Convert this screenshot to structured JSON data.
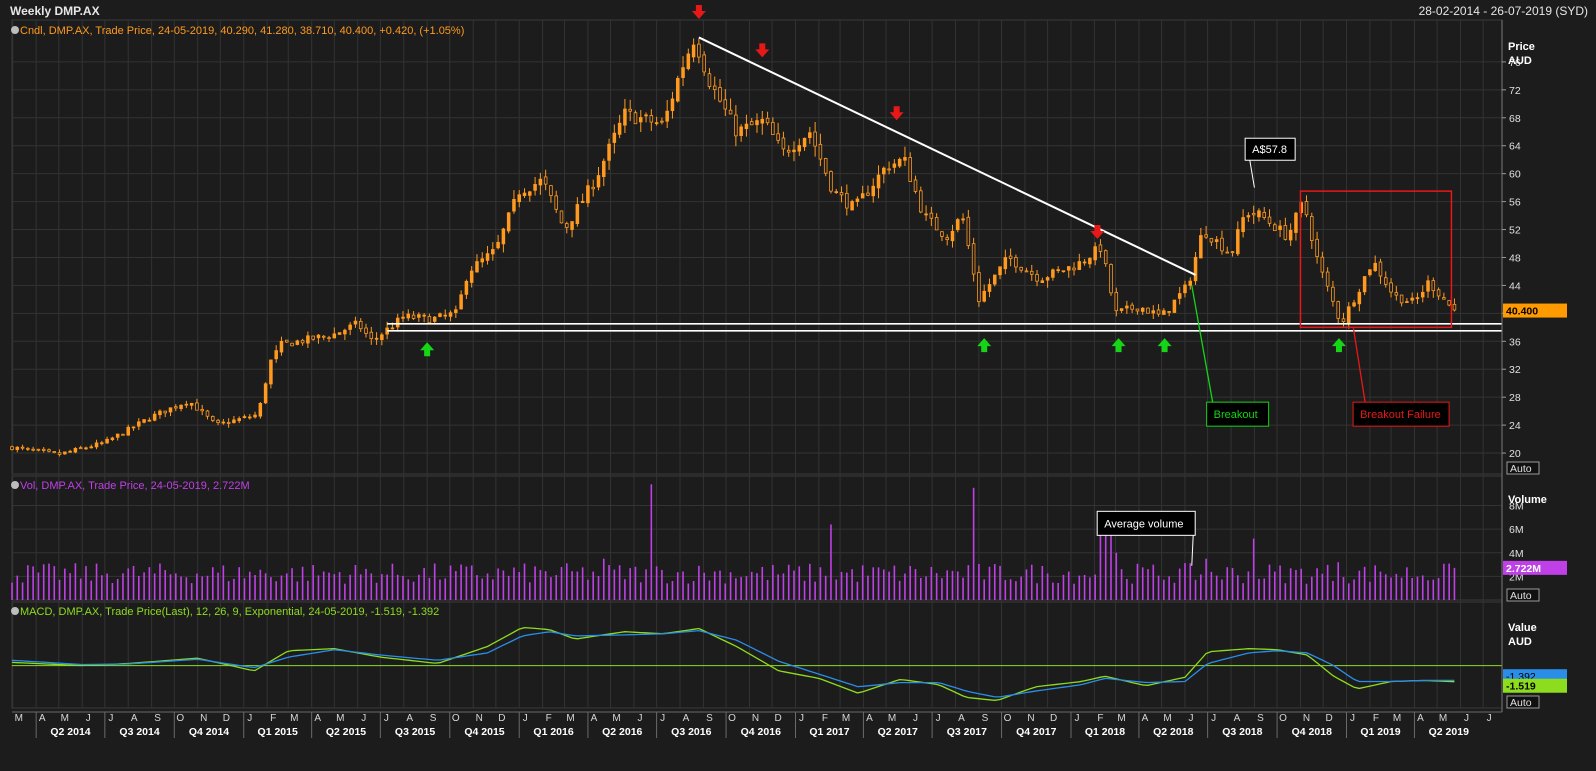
{
  "header": {
    "title": "Weekly DMP.AX",
    "range": "28-02-2014 - 26-07-2019 (SYD)"
  },
  "colors": {
    "candle": "#ff9a1f",
    "volume": "#c040e8",
    "macd": "#8ddc1e",
    "signal": "#2a8de8",
    "background": "#1c1c1c",
    "grid": "#333333",
    "annotation_white": "#ffffff",
    "annotation_green": "#16d416",
    "annotation_red": "#e81818"
  },
  "chart_data": [
    {
      "type": "candlestick",
      "name": "price",
      "legend": "Cndl, DMP.AX, Trade Price, 24-05-2019, 40.290, 41.280, 38.710, 40.400, +0.420, (+1.05%)",
      "ylabel": "Price",
      "yunit": "AUD",
      "ylim": [
        17,
        82
      ],
      "yticks": [
        20,
        24,
        28,
        32,
        36,
        40,
        44,
        48,
        52,
        56,
        60,
        64,
        68,
        72,
        76
      ],
      "last_value_label": "40.400",
      "auto_label": "Auto",
      "close_anchors": [
        [
          "2014-02-28",
          20.8
        ],
        [
          "2014-05-01",
          19.8
        ],
        [
          "2014-07-01",
          21.5
        ],
        [
          "2014-09-01",
          25.2
        ],
        [
          "2014-10-20",
          27.5
        ],
        [
          "2014-11-25",
          24.0
        ],
        [
          "2015-01-20",
          25.5
        ],
        [
          "2015-02-05",
          33.0
        ],
        [
          "2015-02-20",
          35.5
        ],
        [
          "2015-05-01",
          37.0
        ],
        [
          "2015-06-01",
          38.5
        ],
        [
          "2015-06-20",
          36.0
        ],
        [
          "2015-08-01",
          39.5
        ],
        [
          "2015-09-10",
          39.2
        ],
        [
          "2015-10-10",
          40.0
        ],
        [
          "2015-10-25",
          46.0
        ],
        [
          "2015-12-01",
          49.0
        ],
        [
          "2016-01-01",
          57.5
        ],
        [
          "2016-02-01",
          59.0
        ],
        [
          "2016-03-01",
          52.0
        ],
        [
          "2016-04-10",
          59.0
        ],
        [
          "2016-05-20",
          68.5
        ],
        [
          "2016-07-10",
          67.0
        ],
        [
          "2016-08-01",
          74.5
        ],
        [
          "2016-08-20",
          79.5
        ],
        [
          "2016-09-10",
          73.0
        ],
        [
          "2016-10-15",
          66.0
        ],
        [
          "2016-11-20",
          67.5
        ],
        [
          "2016-12-15",
          63.0
        ],
        [
          "2017-01-20",
          66.0
        ],
        [
          "2017-02-20",
          57.5
        ],
        [
          "2017-03-20",
          55.0
        ],
        [
          "2017-05-01",
          61.0
        ],
        [
          "2017-05-25",
          62.0
        ],
        [
          "2017-06-20",
          54.0
        ],
        [
          "2017-07-20",
          51.0
        ],
        [
          "2017-08-10",
          54.0
        ],
        [
          "2017-09-01",
          42.0
        ],
        [
          "2017-10-10",
          48.0
        ],
        [
          "2017-11-20",
          45.0
        ],
        [
          "2018-01-10",
          47.0
        ],
        [
          "2018-02-10",
          49.5
        ],
        [
          "2018-03-01",
          40.0
        ],
        [
          "2018-04-01",
          41.0
        ],
        [
          "2018-05-01",
          39.5
        ],
        [
          "2018-06-05",
          44.0
        ],
        [
          "2018-06-25",
          52.0
        ],
        [
          "2018-08-01",
          48.5
        ],
        [
          "2018-08-20",
          54.5
        ],
        [
          "2018-09-10",
          54.0
        ],
        [
          "2018-10-15",
          51.0
        ],
        [
          "2018-11-05",
          56.0
        ],
        [
          "2018-11-25",
          47.0
        ],
        [
          "2018-12-25",
          38.5
        ],
        [
          "2019-02-05",
          47.5
        ],
        [
          "2019-03-05",
          42.5
        ],
        [
          "2019-04-01",
          41.5
        ],
        [
          "2019-04-20",
          44.5
        ],
        [
          "2019-05-24",
          40.4
        ]
      ],
      "annotations": {
        "resistance_line": {
          "from": [
            "2016-08-26",
            79.5
          ],
          "to": [
            "2018-06-15",
            45.5
          ]
        },
        "support_lines": [
          {
            "from": [
              "2015-07-10",
              38.5
            ],
            "to": [
              "2019-07-26",
              38.5
            ]
          },
          {
            "from": [
              "2015-07-10",
              37.5
            ],
            "to": [
              "2019-07-26",
              37.5
            ]
          }
        ],
        "red_arrows": [
          [
            "2016-08-26",
            83.0
          ],
          [
            "2016-11-18",
            77.5
          ],
          [
            "2017-05-15",
            68.5
          ],
          [
            "2018-02-05",
            51.5
          ]
        ],
        "green_arrows": [
          [
            "2015-09-01",
            35.0
          ],
          [
            "2017-09-08",
            35.6
          ],
          [
            "2018-03-05",
            35.6
          ],
          [
            "2018-05-05",
            35.6
          ],
          [
            "2018-12-22",
            35.6
          ]
        ],
        "price_callout": {
          "text": "A$57.8",
          "at": [
            "2018-09-01",
            58.0
          ],
          "box": [
            "2018-08-25",
            64.5
          ]
        },
        "breakout_label": {
          "text": "Breakout",
          "at": [
            "2018-06-10",
            44.0
          ],
          "box": [
            "2018-07-05",
            27.0
          ]
        },
        "failure_box": {
          "from": [
            "2018-11-01",
            57.5
          ],
          "to": [
            "2019-05-20",
            38.0
          ]
        },
        "failure_label": {
          "text": "Breakout Failure",
          "box": [
            "2019-01-15",
            27.0
          ]
        }
      }
    },
    {
      "type": "bar",
      "name": "volume",
      "legend": "Vol, DMP.AX, Trade Price, 24-05-2019, 2.722M",
      "ylabel": "Volume",
      "yticks": [
        2,
        4,
        6,
        8
      ],
      "ytick_labels": [
        "2M",
        "4M",
        "6M",
        "8M"
      ],
      "ylim": [
        0,
        10.5
      ],
      "last_value_label": "2.722M",
      "auto_label": "Auto",
      "typical_value": 2.5,
      "spikes": [
        [
          "2016-06-24",
          9.8
        ],
        [
          "2016-04-22",
          3.5
        ],
        [
          "2017-02-17",
          6.4
        ],
        [
          "2017-08-25",
          9.5
        ],
        [
          "2018-02-09",
          5.5
        ],
        [
          "2018-02-16",
          5.5
        ],
        [
          "2018-02-23",
          5.5
        ],
        [
          "2018-03-02",
          4.0
        ],
        [
          "2018-06-29",
          3.5
        ],
        [
          "2018-08-31",
          5.2
        ],
        [
          "2018-12-21",
          3.2
        ],
        [
          "2019-02-15",
          2.4
        ],
        [
          "2019-05-24",
          2.72
        ]
      ],
      "annotation": {
        "text": "Average volume",
        "at": [
          "2018-06-10",
          2.9
        ],
        "box": [
          "2018-02-10",
          7.0
        ]
      }
    },
    {
      "type": "line",
      "name": "macd",
      "legend": "MACD, DMP.AX, Trade Price(Last), 12, 26, 9, Exponential, 24-05-2019, -1.519, -1.392",
      "ylabel": "Value",
      "yunit": "AUD",
      "zero_line": 0,
      "ylim": [
        -4,
        6
      ],
      "value_labels": [
        "-1.392",
        "-1.519"
      ],
      "auto_label": "Auto",
      "series": [
        {
          "name": "MACD",
          "color_key": "macd",
          "points": [
            [
              "2014-02-28",
              0.3
            ],
            [
              "2014-06-01",
              0.0
            ],
            [
              "2014-08-01",
              0.2
            ],
            [
              "2014-11-01",
              0.7
            ],
            [
              "2015-01-15",
              -0.5
            ],
            [
              "2015-03-01",
              1.4
            ],
            [
              "2015-05-01",
              1.6
            ],
            [
              "2015-07-01",
              0.8
            ],
            [
              "2015-09-15",
              0.2
            ],
            [
              "2015-11-20",
              1.8
            ],
            [
              "2016-01-05",
              3.6
            ],
            [
              "2016-02-10",
              3.4
            ],
            [
              "2016-03-15",
              2.5
            ],
            [
              "2016-05-20",
              3.2
            ],
            [
              "2016-07-10",
              3.0
            ],
            [
              "2016-08-26",
              3.5
            ],
            [
              "2016-10-15",
              1.8
            ],
            [
              "2016-12-10",
              -0.5
            ],
            [
              "2017-02-01",
              -1.2
            ],
            [
              "2017-03-25",
              -2.6
            ],
            [
              "2017-05-20",
              -1.3
            ],
            [
              "2017-07-10",
              -1.8
            ],
            [
              "2017-08-15",
              -3.0
            ],
            [
              "2017-09-25",
              -3.3
            ],
            [
              "2017-11-15",
              -2.0
            ],
            [
              "2018-01-15",
              -1.5
            ],
            [
              "2018-02-15",
              -1.0
            ],
            [
              "2018-04-10",
              -1.9
            ],
            [
              "2018-06-01",
              -1.1
            ],
            [
              "2018-07-01",
              1.3
            ],
            [
              "2018-08-25",
              1.6
            ],
            [
              "2018-10-01",
              1.5
            ],
            [
              "2018-11-10",
              1.0
            ],
            [
              "2018-12-15",
              -1.0
            ],
            [
              "2019-01-15",
              -2.2
            ],
            [
              "2019-03-01",
              -1.5
            ],
            [
              "2019-04-15",
              -1.4
            ],
            [
              "2019-05-24",
              -1.519
            ]
          ]
        },
        {
          "name": "Signal",
          "color_key": "signal",
          "points": [
            [
              "2014-02-28",
              0.5
            ],
            [
              "2014-06-01",
              0.1
            ],
            [
              "2014-08-01",
              0.15
            ],
            [
              "2014-11-01",
              0.6
            ],
            [
              "2015-01-15",
              -0.2
            ],
            [
              "2015-03-01",
              0.8
            ],
            [
              "2015-05-01",
              1.5
            ],
            [
              "2015-07-01",
              1.0
            ],
            [
              "2015-09-15",
              0.5
            ],
            [
              "2015-11-20",
              1.2
            ],
            [
              "2016-01-05",
              2.8
            ],
            [
              "2016-02-10",
              3.2
            ],
            [
              "2016-03-15",
              2.8
            ],
            [
              "2016-05-20",
              2.9
            ],
            [
              "2016-07-10",
              3.0
            ],
            [
              "2016-08-26",
              3.3
            ],
            [
              "2016-10-15",
              2.4
            ],
            [
              "2016-12-10",
              0.4
            ],
            [
              "2017-02-01",
              -0.8
            ],
            [
              "2017-03-25",
              -2.0
            ],
            [
              "2017-05-20",
              -1.6
            ],
            [
              "2017-07-10",
              -1.6
            ],
            [
              "2017-08-15",
              -2.4
            ],
            [
              "2017-09-25",
              -3.0
            ],
            [
              "2017-11-15",
              -2.4
            ],
            [
              "2018-01-15",
              -1.8
            ],
            [
              "2018-02-15",
              -1.2
            ],
            [
              "2018-04-10",
              -1.6
            ],
            [
              "2018-06-01",
              -1.5
            ],
            [
              "2018-07-01",
              0.2
            ],
            [
              "2018-08-25",
              1.2
            ],
            [
              "2018-10-01",
              1.4
            ],
            [
              "2018-11-10",
              1.2
            ],
            [
              "2018-12-15",
              0.0
            ],
            [
              "2019-01-15",
              -1.5
            ],
            [
              "2019-03-01",
              -1.5
            ],
            [
              "2019-04-15",
              -1.4
            ],
            [
              "2019-05-24",
              -1.392
            ]
          ]
        }
      ]
    }
  ],
  "time_axis": {
    "start": "2014-02-28",
    "end": "2019-07-26",
    "month_labels": [
      "M",
      "A",
      "M",
      "J",
      "J",
      "A",
      "S",
      "O",
      "N",
      "D",
      "J",
      "F",
      "M",
      "A",
      "M",
      "J",
      "J",
      "A",
      "S",
      "O",
      "N",
      "D",
      "J",
      "F",
      "M",
      "A",
      "M",
      "J",
      "J",
      "A",
      "S",
      "O",
      "N",
      "D",
      "J",
      "F",
      "M",
      "A",
      "M",
      "J",
      "J",
      "A",
      "S",
      "O",
      "N",
      "D",
      "J",
      "F",
      "M",
      "A",
      "M",
      "J",
      "J",
      "A",
      "S",
      "O",
      "N",
      "D",
      "J",
      "F",
      "M",
      "A",
      "M",
      "J",
      "J"
    ],
    "quarter_labels": [
      "Q2 2014",
      "Q3 2014",
      "Q4 2014",
      "Q1 2015",
      "Q2 2015",
      "Q3 2015",
      "Q4 2015",
      "Q1 2016",
      "Q2 2016",
      "Q3 2016",
      "Q4 2016",
      "Q1 2017",
      "Q2 2017",
      "Q3 2017",
      "Q4 2017",
      "Q1 2018",
      "Q2 2018",
      "Q3 2018",
      "Q4 2018",
      "Q1 2019",
      "Q2 2019"
    ]
  }
}
